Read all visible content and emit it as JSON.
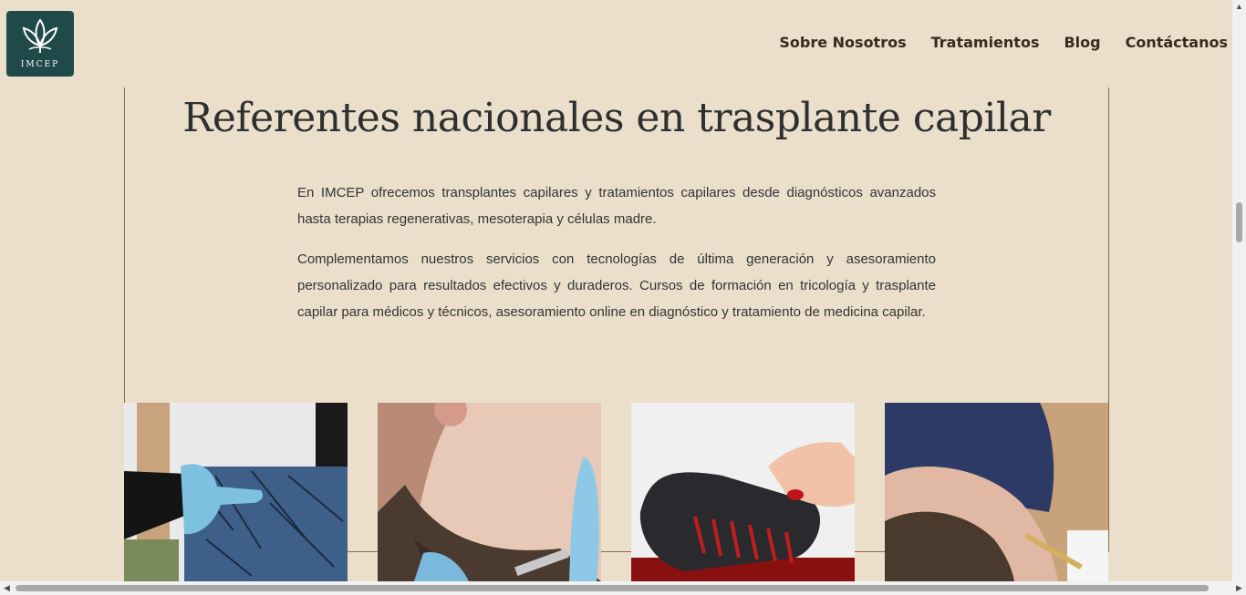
{
  "header": {
    "logo_text": "IMCEP",
    "nav": [
      "Sobre Nosotros",
      "Tratamientos",
      "Blog",
      "Contáctanos"
    ]
  },
  "main": {
    "title": "Referentes nacionales en trasplante capilar",
    "paragraphs": [
      "En IMCEP ofrecemos transplantes capilares y tratamientos capilares desde diagnósticos avanzados hasta terapias regenerativas, mesoterapia y células madre.",
      "Complementamos nuestros servicios con tecnologías de última generación y asesoramiento personalizado para resultados efectivos y duraderos. Cursos de formación en tricología y trasplante capilar para médicos y técnicos, asesoramiento online en diagnóstico y tratamiento de medicina capilar."
    ]
  },
  "colors": {
    "background": "#ebdfcc",
    "logo_bg": "#1f4a49",
    "nav_text": "#3a2a1c",
    "frame_lines": "#8a6a4a"
  }
}
